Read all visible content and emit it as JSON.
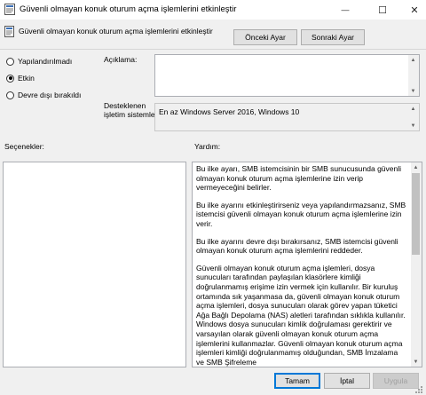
{
  "window": {
    "title": "Güvenli olmayan konuk oturum açma işlemlerini etkinleştir",
    "minimize_glyph": "—",
    "maximize_glyph": "☐",
    "close_glyph": "✕"
  },
  "header": {
    "policy_name": "Güvenli olmayan konuk oturum açma işlemlerini etkinleştir",
    "prev_label": "Önceki Ayar",
    "next_label": "Sonraki Ayar"
  },
  "state": {
    "options": [
      {
        "label": "Yapılandırılmadı",
        "selected": false
      },
      {
        "label": "Etkin",
        "selected": true
      },
      {
        "label": "Devre dışı bırakıldı",
        "selected": false
      }
    ]
  },
  "comment": {
    "label": "Açıklama:",
    "value": ""
  },
  "supported": {
    "label_line1": "Desteklenen",
    "label_line2": "işletim sistemleri:",
    "value": "En az Windows Server 2016, Windows 10"
  },
  "options_section": {
    "label": "Seçenekler:"
  },
  "help_section": {
    "label": "Yardım:",
    "paragraphs": [
      "Bu ilke ayarı, SMB istemcisinin bir SMB sunucusunda güvenli olmayan konuk oturum açma işlemlerine izin verip vermeyeceğini belirler.",
      "Bu ilke ayarını etkinleştirirseniz veya yapılandırmazsanız, SMB istemcisi güvenli olmayan konuk oturum açma işlemlerine izin verir.",
      "Bu ilke ayarını devre dışı bırakırsanız, SMB istemcisi güvenli olmayan konuk oturum açma işlemlerini reddeder.",
      "Güvenli olmayan konuk oturum açma işlemleri, dosya sunucuları tarafından paylaşılan klasörlere kimliği doğrulanmamış erişime izin vermek için kullanılır. Bir kuruluş ortamında sık yaşanmasa da, güvenli olmayan konuk oturum açma işlemleri, dosya sunucuları olarak görev yapan tüketici Ağa Bağlı Depolama (NAS) aletleri tarafından sıklıkla kullanılır. Windows dosya sunucuları kimlik doğrulaması gerektirir ve varsayılan olarak güvenli olmayan konuk oturum açma işlemlerini kullanmazlar. Güvenli olmayan konuk oturum açma işlemleri kimliği doğrulanmamış olduğundan, SMB İmzalama ve SMB Şifreleme"
    ]
  },
  "footer": {
    "ok_label": "Tamam",
    "cancel_label": "İptal",
    "apply_label": "Uygula"
  }
}
